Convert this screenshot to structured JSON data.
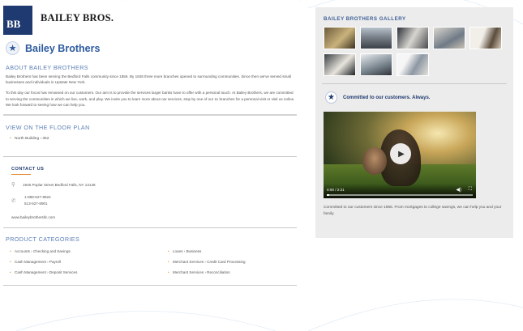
{
  "brand": {
    "logo_mark": "BB",
    "logo_name": "BAILEY BROS.",
    "title": "Bailey Brothers",
    "title_icon": "star-icon"
  },
  "about": {
    "heading": "ABOUT BAILEY BROTHERS",
    "para1": "Bailey Brothers has been serving the Bedford Falls community since 1856. By 1928 three more branches opened to surrounding communities. Since then we've served small businesses and individuals in Upstate New York.",
    "para2": "To this day our focus has remained on our customers. Our aim is to provide the services larger banks have to offer with a personal touch. At Bailey Brothers, we are committed to serving the communities in which we live, work, and play. We invite you to learn more about our services, stop by one of our 11 branches for a personal visit or visit us online. We look forward to seeing how we can help you."
  },
  "floor_plan": {
    "heading": "VIEW ON THE FLOOR PLAN",
    "item": "North Building › 352"
  },
  "contact": {
    "heading": "CONTACT US",
    "address": "1946 Poplar Street Bedford Falls, NY 13148",
    "phone1": "1-888-527-8922",
    "phone2": "513-527-8901",
    "website": "www.baileybrothersllc.com",
    "icons": [
      "map-pin-icon",
      "phone-icon"
    ]
  },
  "categories": {
    "heading": "PRODUCT CATEGORIES",
    "items": [
      "Accounts › Checking and Savings",
      "Loans › Business",
      "Cash Management › Payroll",
      "Merchant Services › Credit Card Processing",
      "Cash Management › Deposit Services",
      "Merchant Services › Reconciliation"
    ]
  },
  "gallery": {
    "heading": "BAILEY BROTHERS GALLERY",
    "thumb_count": 8
  },
  "commitment": {
    "heading": "Committed to our customers. Always.",
    "video_time": "0:00 / 2:21",
    "caption": "Committed to our customers since 1856. From mortgages to college savings, we can help you and your family."
  },
  "colors": {
    "brand_navy": "#1f3a70",
    "link_blue": "#2d5a9e",
    "accent_orange": "#e48a2a",
    "sidebar_gray": "#ececec"
  }
}
